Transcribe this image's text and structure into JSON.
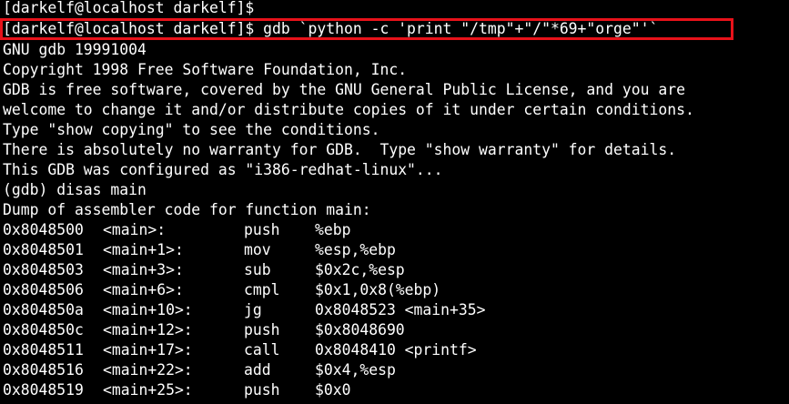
{
  "colors": {
    "background": "#000000",
    "text": "#ffffff",
    "highlight_border": "#e8121a"
  },
  "terminal": {
    "lines": [
      "[darkelf@localhost darkelf]$",
      "[darkelf@localhost darkelf]$ gdb `python -c 'print \"/tmp\"+\"/\"*69+\"orge\"'`",
      "GNU gdb 19991004",
      "Copyright 1998 Free Software Foundation, Inc.",
      "GDB is free software, covered by the GNU General Public License, and you are",
      "welcome to change it and/or distribute copies of it under certain conditions.",
      "Type \"show copying\" to see the conditions.",
      "There is absolutely no warranty for GDB.  Type \"show warranty\" for details.",
      "This GDB was configured as \"i386-redhat-linux\"...",
      "(gdb) disas main",
      "Dump of assembler code for function main:"
    ],
    "disassembly": [
      {
        "address": "0x8048500",
        "symbol": "<main>:",
        "instruction": "push",
        "operands": "%ebp"
      },
      {
        "address": "0x8048501",
        "symbol": "<main+1>:",
        "instruction": "mov",
        "operands": "%esp,%ebp"
      },
      {
        "address": "0x8048503",
        "symbol": "<main+3>:",
        "instruction": "sub",
        "operands": "$0x2c,%esp"
      },
      {
        "address": "0x8048506",
        "symbol": "<main+6>:",
        "instruction": "cmpl",
        "operands": "$0x1,0x8(%ebp)"
      },
      {
        "address": "0x804850a",
        "symbol": "<main+10>:",
        "instruction": "jg",
        "operands": "0x8048523 <main+35>"
      },
      {
        "address": "0x804850c",
        "symbol": "<main+12>:",
        "instruction": "push",
        "operands": "$0x8048690"
      },
      {
        "address": "0x8048511",
        "symbol": "<main+17>:",
        "instruction": "call",
        "operands": "0x8048410 <printf>"
      },
      {
        "address": "0x8048516",
        "symbol": "<main+22>:",
        "instruction": "add",
        "operands": "$0x4,%esp"
      },
      {
        "address": "0x8048519",
        "symbol": "<main+25>:",
        "instruction": "push",
        "operands": "$0x0"
      }
    ]
  }
}
